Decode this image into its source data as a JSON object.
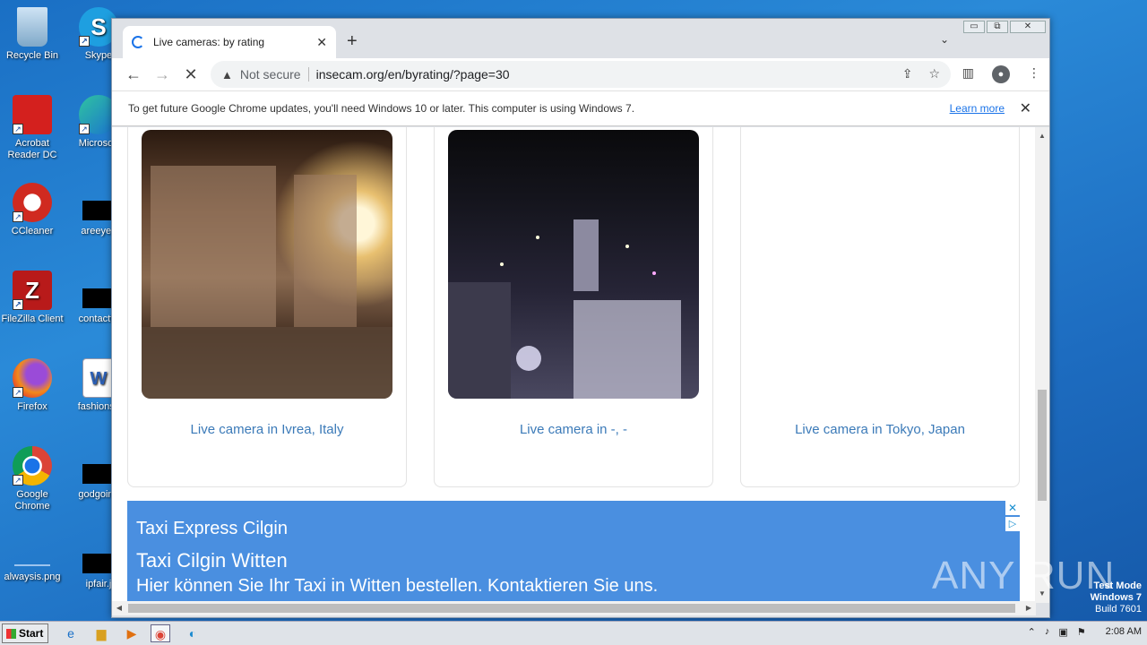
{
  "desktop": {
    "icons": [
      {
        "label": "Recycle Bin"
      },
      {
        "label": "Skype"
      },
      {
        "label": "Acrobat Reader DC"
      },
      {
        "label": "Microsoft"
      },
      {
        "label": "CCleaner"
      },
      {
        "label": "areeyes"
      },
      {
        "label": "FileZilla Client"
      },
      {
        "label": "contactfri"
      },
      {
        "label": "Firefox"
      },
      {
        "label": "fashionsy"
      },
      {
        "label": "Google Chrome"
      },
      {
        "label": "godgoing"
      },
      {
        "label": "alwaysis.png"
      },
      {
        "label": "ipfair.j"
      }
    ]
  },
  "browser": {
    "tab": {
      "title": "Live cameras: by rating",
      "close": "✕"
    },
    "new_tab": "+",
    "tab_menu": "⌄",
    "window_controls": {
      "minimize": "▭",
      "restore": "⧉",
      "close": "✕"
    },
    "toolbar": {
      "back": "←",
      "forward": "→",
      "reload": "✕",
      "security": "Not secure",
      "url": "insecam.org/en/byrating/?page=30"
    },
    "infobar": {
      "message": "To get future Google Chrome updates, you'll need Windows 10 or later. This computer is using Windows 7.",
      "link": "Learn more",
      "close": "✕"
    }
  },
  "page": {
    "cameras": [
      {
        "caption": "Live camera in Ivrea, Italy"
      },
      {
        "caption": "Live camera in -, -"
      },
      {
        "caption": "Live camera in Tokyo, Japan"
      }
    ],
    "ad": {
      "line1": "Taxi Express Cilgin",
      "line2": "Taxi Cilgin Witten",
      "line3": "Hier können Sie Ihr Taxi in Witten bestellen. Kontaktieren Sie uns.",
      "close": "✕",
      "info": "▷"
    }
  },
  "watermark": {
    "logo": "ANY RUN",
    "test_mode": "Test Mode",
    "os": "Windows 7",
    "build": "Build 7601"
  },
  "taskbar": {
    "start": "Start",
    "clock": "2:08 AM"
  }
}
